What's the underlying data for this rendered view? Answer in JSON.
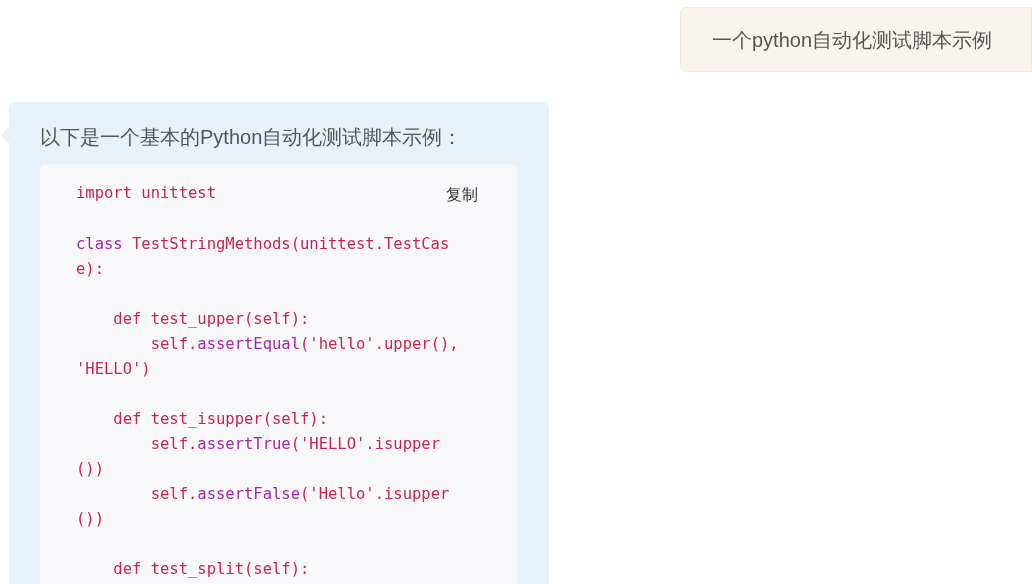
{
  "user_message": {
    "text": "一个python自动化测试脚本示例"
  },
  "assistant_message": {
    "intro": "以下是一个基本的Python自动化测试脚本示例：",
    "code_block": {
      "copy_label": "复制",
      "lines": [
        {
          "kind": "code",
          "segments": [
            {
              "kind": "plain",
              "text": "import unittest"
            }
          ]
        },
        {
          "kind": "blank"
        },
        {
          "kind": "code",
          "segments": [
            {
              "kind": "keyword",
              "text": "class"
            },
            {
              "kind": "plain",
              "text": " TestStringMethods(unittest.TestCase):"
            }
          ]
        },
        {
          "kind": "blank"
        },
        {
          "kind": "code",
          "segments": [
            {
              "kind": "plain",
              "text": "    def test_upper(self):"
            }
          ]
        },
        {
          "kind": "code",
          "segments": [
            {
              "kind": "plain",
              "text": "        self."
            },
            {
              "kind": "keyword",
              "text": "assertEqual"
            },
            {
              "kind": "plain",
              "text": "('hello'.upper(), 'HELLO')"
            }
          ]
        },
        {
          "kind": "blank"
        },
        {
          "kind": "code",
          "segments": [
            {
              "kind": "plain",
              "text": "    def test_isupper(self):"
            }
          ]
        },
        {
          "kind": "code",
          "segments": [
            {
              "kind": "plain",
              "text": "        self."
            },
            {
              "kind": "keyword",
              "text": "assertTrue"
            },
            {
              "kind": "plain",
              "text": "('HELLO'.isupper())"
            }
          ]
        },
        {
          "kind": "code",
          "segments": [
            {
              "kind": "plain",
              "text": "        self."
            },
            {
              "kind": "keyword",
              "text": "assertFalse"
            },
            {
              "kind": "plain",
              "text": "('Hello'.isupper())"
            }
          ]
        },
        {
          "kind": "blank"
        },
        {
          "kind": "code",
          "segments": [
            {
              "kind": "plain",
              "text": "    def test_split(self):"
            }
          ]
        }
      ]
    }
  }
}
